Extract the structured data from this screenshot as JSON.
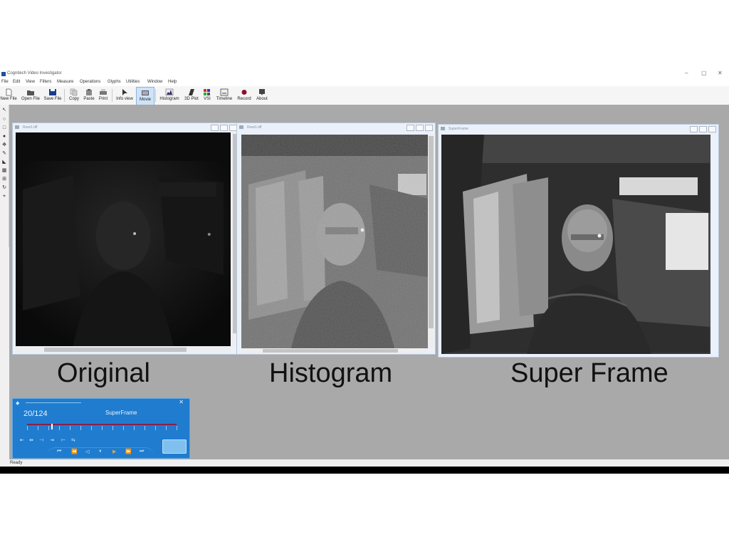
{
  "window": {
    "title": "Cognitech Video Investigator",
    "controls": {
      "minimize": "–",
      "restore": "▢",
      "close": "✕"
    }
  },
  "menu": [
    "File",
    "Edit",
    "View",
    "Filters",
    "Measure",
    "Operations",
    "Glyphs",
    "Utilities",
    "Window",
    "Help"
  ],
  "toolbar": [
    {
      "label": "New File",
      "icon": "new-file-icon"
    },
    {
      "label": "Open File",
      "icon": "open-file-icon"
    },
    {
      "label": "Save File",
      "icon": "save-file-icon"
    },
    {
      "label": "Copy",
      "icon": "copy-icon"
    },
    {
      "label": "Paste",
      "icon": "paste-icon"
    },
    {
      "label": "Print",
      "icon": "print-icon"
    },
    {
      "label": "Info view",
      "icon": "info-view-icon"
    },
    {
      "label": "Movie",
      "icon": "movie-icon",
      "active": true
    },
    {
      "label": "Histogram",
      "icon": "histogram-icon"
    },
    {
      "label": "3D Plot",
      "icon": "3d-plot-icon"
    },
    {
      "label": "VSI",
      "icon": "vsi-icon"
    },
    {
      "label": "Timeline",
      "icon": "timeline-icon"
    },
    {
      "label": "Record",
      "icon": "record-icon"
    },
    {
      "label": "About",
      "icon": "about-icon"
    }
  ],
  "image_windows": [
    {
      "name": "Rewi1.tiff",
      "caption": "Original"
    },
    {
      "name": "Rewi1.tiff",
      "caption": "Histogram"
    },
    {
      "name": "SuperFrame",
      "caption": "Super Frame"
    }
  ],
  "player": {
    "counter": "20/124",
    "name": "SuperFrame",
    "position": 0.161,
    "buttons": [
      "first-frame",
      "prev-key",
      "prev-frame",
      "pause",
      "play",
      "next-frame",
      "last-frame"
    ]
  },
  "status": {
    "text": "Ready"
  },
  "colors": {
    "workspace": "#a9a9a9",
    "player_bg": "#1f7ccf",
    "track": "#8a1f4a"
  }
}
